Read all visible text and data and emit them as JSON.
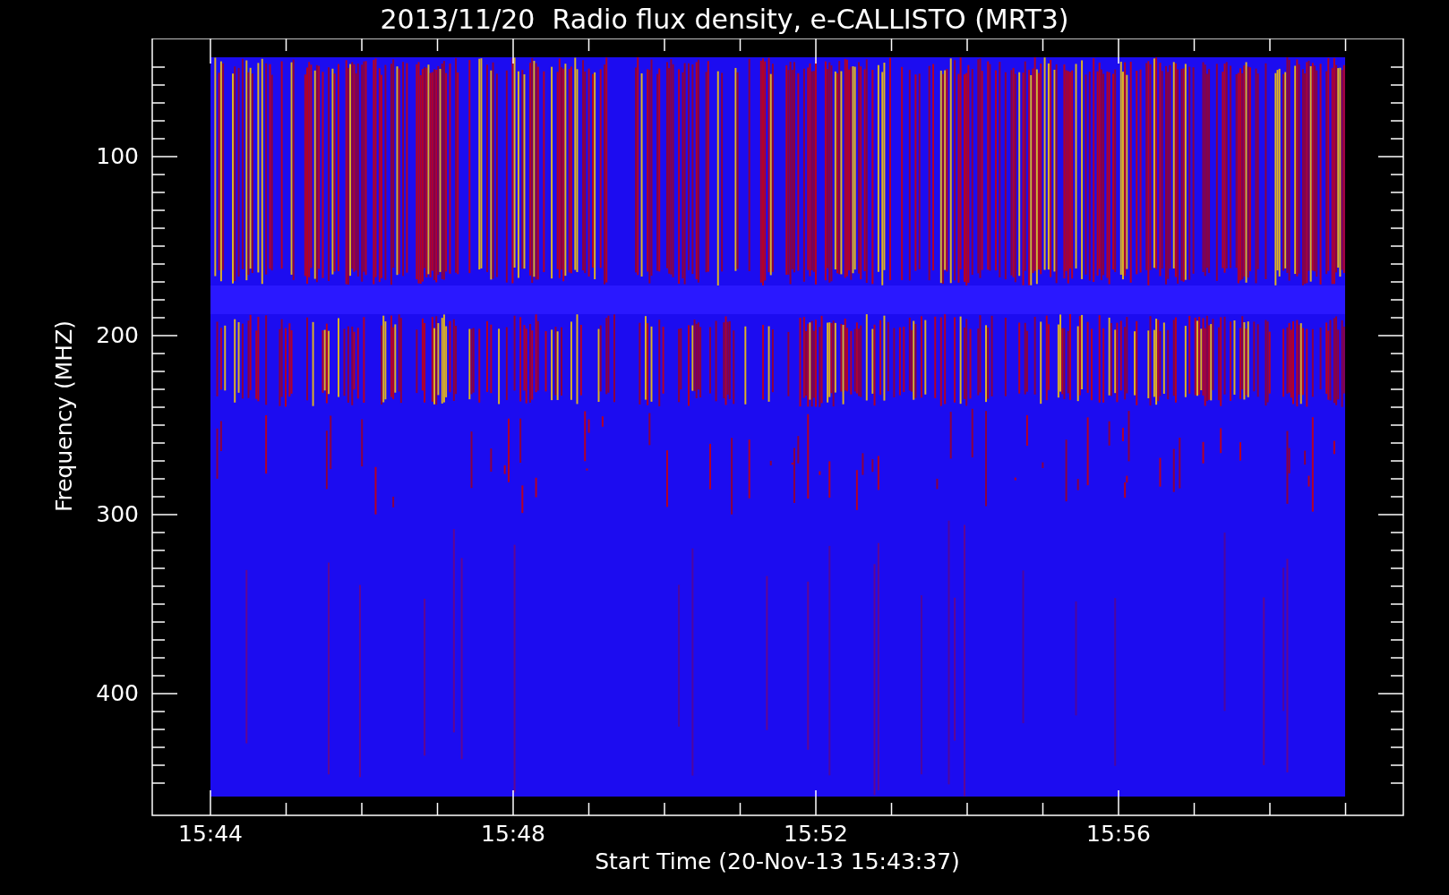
{
  "title": "2013/11/20  Radio flux density, e-CALLISTO (MRT3)",
  "y_axis": {
    "label": "Frequency (MHZ)",
    "ticks": [
      "100",
      "200",
      "300",
      "400"
    ]
  },
  "x_axis": {
    "label": "Start Time (20-Nov-13 15:43:37)",
    "ticks": [
      "15:44",
      "15:48",
      "15:52",
      "15:56"
    ]
  }
}
